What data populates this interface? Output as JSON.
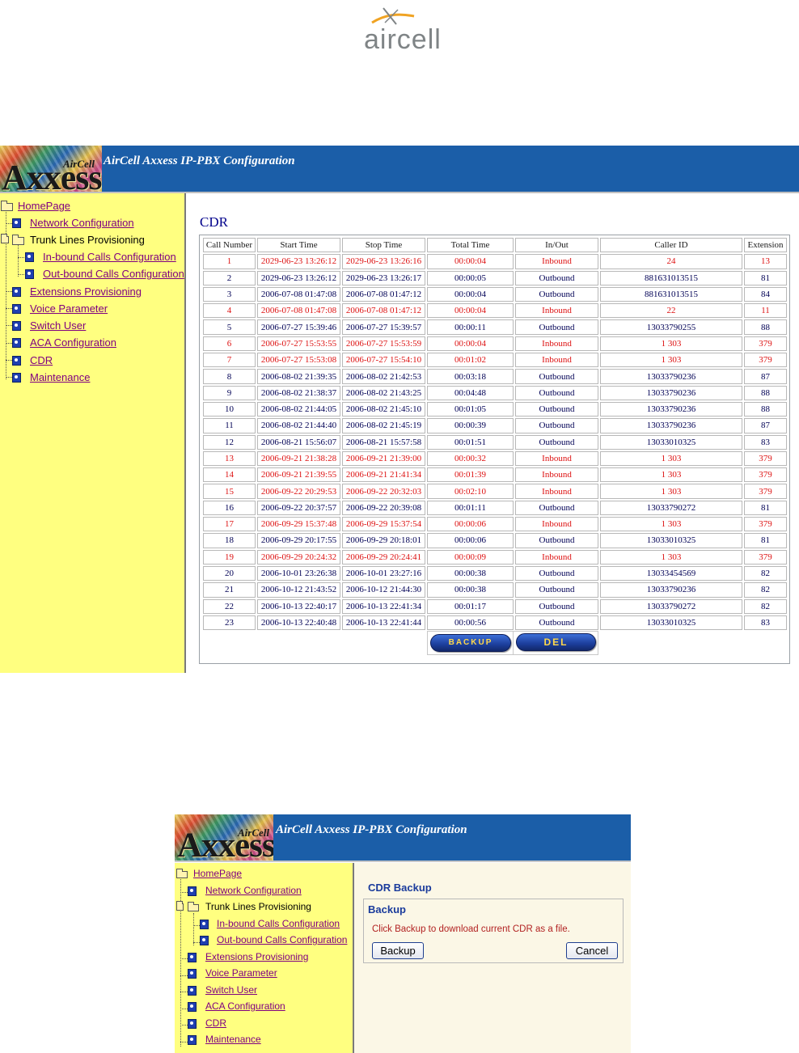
{
  "logo": {
    "text": "aircell",
    "icon": "aircell-swoosh-logo"
  },
  "app1": {
    "header_title": "AirCell Axxess IP-PBX Configuration",
    "brand_main": "Axxess",
    "brand_sup": "AirCell",
    "nav": [
      {
        "label": "HomePage",
        "icon": "folder-icon"
      },
      {
        "label": "Network Configuration",
        "icon": "page-icon"
      },
      {
        "label": "Trunk Lines Provisioning",
        "icon": "folder-icon"
      },
      {
        "label": "In-bound Calls Configuration",
        "icon": "page-icon"
      },
      {
        "label": "Out-bound Calls Configuration",
        "icon": "page-icon"
      },
      {
        "label": "Extensions Provisioning",
        "icon": "page-icon"
      },
      {
        "label": "Voice Parameter",
        "icon": "page-icon"
      },
      {
        "label": "Switch User",
        "icon": "page-icon"
      },
      {
        "label": "ACA Configuration",
        "icon": "page-icon"
      },
      {
        "label": "CDR",
        "icon": "page-icon"
      },
      {
        "label": "Maintenance",
        "icon": "page-icon"
      }
    ],
    "cdr_title": "CDR",
    "table": {
      "headers": [
        "Call Number",
        "Start Time",
        "Stop Time",
        "Total Time",
        "In/Out",
        "Caller ID",
        "Extension"
      ],
      "rows": [
        [
          "1",
          "2029-06-23 13:26:12",
          "2029-06-23 13:26:16",
          "00:00:04",
          "Inbound",
          "24",
          "13"
        ],
        [
          "2",
          "2029-06-23 13:26:12",
          "2029-06-23 13:26:17",
          "00:00:05",
          "Outbound",
          "881631013515",
          "81"
        ],
        [
          "3",
          "2006-07-08 01:47:08",
          "2006-07-08 01:47:12",
          "00:00:04",
          "Outbound",
          "881631013515",
          "84"
        ],
        [
          "4",
          "2006-07-08 01:47:08",
          "2006-07-08 01:47:12",
          "00:00:04",
          "Inbound",
          "22",
          "11"
        ],
        [
          "5",
          "2006-07-27 15:39:46",
          "2006-07-27 15:39:57",
          "00:00:11",
          "Outbound",
          "13033790255",
          "88"
        ],
        [
          "6",
          "2006-07-27 15:53:55",
          "2006-07-27 15:53:59",
          "00:00:04",
          "Inbound",
          "1 303",
          "379"
        ],
        [
          "7",
          "2006-07-27 15:53:08",
          "2006-07-27 15:54:10",
          "00:01:02",
          "Inbound",
          "1 303",
          "379"
        ],
        [
          "8",
          "2006-08-02 21:39:35",
          "2006-08-02 21:42:53",
          "00:03:18",
          "Outbound",
          "13033790236",
          "87"
        ],
        [
          "9",
          "2006-08-02 21:38:37",
          "2006-08-02 21:43:25",
          "00:04:48",
          "Outbound",
          "13033790236",
          "88"
        ],
        [
          "10",
          "2006-08-02 21:44:05",
          "2006-08-02 21:45:10",
          "00:01:05",
          "Outbound",
          "13033790236",
          "88"
        ],
        [
          "11",
          "2006-08-02 21:44:40",
          "2006-08-02 21:45:19",
          "00:00:39",
          "Outbound",
          "13033790236",
          "87"
        ],
        [
          "12",
          "2006-08-21 15:56:07",
          "2006-08-21 15:57:58",
          "00:01:51",
          "Outbound",
          "13033010325",
          "83"
        ],
        [
          "13",
          "2006-09-21 21:38:28",
          "2006-09-21 21:39:00",
          "00:00:32",
          "Inbound",
          "1 303",
          "379"
        ],
        [
          "14",
          "2006-09-21 21:39:55",
          "2006-09-21 21:41:34",
          "00:01:39",
          "Inbound",
          "1 303",
          "379"
        ],
        [
          "15",
          "2006-09-22 20:29:53",
          "2006-09-22 20:32:03",
          "00:02:10",
          "Inbound",
          "1 303",
          "379"
        ],
        [
          "16",
          "2006-09-22 20:37:57",
          "2006-09-22 20:39:08",
          "00:01:11",
          "Outbound",
          "13033790272",
          "81"
        ],
        [
          "17",
          "2006-09-29 15:37:48",
          "2006-09-29 15:37:54",
          "00:00:06",
          "Inbound",
          "1 303",
          "379"
        ],
        [
          "18",
          "2006-09-29 20:17:55",
          "2006-09-29 20:18:01",
          "00:00:06",
          "Outbound",
          "13033010325",
          "81"
        ],
        [
          "19",
          "2006-09-29 20:24:32",
          "2006-09-29 20:24:41",
          "00:00:09",
          "Inbound",
          "1 303",
          "379"
        ],
        [
          "20",
          "2006-10-01 23:26:38",
          "2006-10-01 23:27:16",
          "00:00:38",
          "Outbound",
          "13033454569",
          "82"
        ],
        [
          "21",
          "2006-10-12 21:43:52",
          "2006-10-12 21:44:30",
          "00:00:38",
          "Outbound",
          "13033790236",
          "82"
        ],
        [
          "22",
          "2006-10-13 22:40:17",
          "2006-10-13 22:41:34",
          "00:01:17",
          "Outbound",
          "13033790272",
          "82"
        ],
        [
          "23",
          "2006-10-13 22:40:48",
          "2006-10-13 22:41:44",
          "00:00:56",
          "Outbound",
          "13033010325",
          "83"
        ]
      ],
      "red_rows": [
        1,
        4,
        6,
        7,
        13,
        14,
        15,
        17,
        19
      ]
    },
    "backup_button": "BACKUP",
    "del_button": "DEL"
  },
  "app2": {
    "header_title": "AirCell Axxess IP-PBX Configuration",
    "brand_main": "Axxess",
    "brand_sup": "AirCell",
    "nav": [
      {
        "label": "HomePage",
        "icon": "folder-icon"
      },
      {
        "label": "Network Configuration",
        "icon": "page-icon"
      },
      {
        "label": "Trunk Lines Provisioning",
        "icon": "folder-icon"
      },
      {
        "label": "In-bound Calls Configuration",
        "icon": "page-icon"
      },
      {
        "label": "Out-bound Calls Configuration",
        "icon": "page-icon"
      },
      {
        "label": "Extensions Provisioning",
        "icon": "page-icon"
      },
      {
        "label": "Voice Parameter",
        "icon": "page-icon"
      },
      {
        "label": "Switch User",
        "icon": "page-icon"
      },
      {
        "label": "ACA Configuration",
        "icon": "page-icon"
      },
      {
        "label": "CDR",
        "icon": "page-icon"
      },
      {
        "label": "Maintenance",
        "icon": "page-icon"
      }
    ],
    "title": "CDR Backup",
    "section_title": "Backup",
    "message": "Click Backup to download current CDR as a file.",
    "backup_button": "Backup",
    "cancel_button": "Cancel"
  },
  "colors": {
    "header_blue": "#1b5ea8",
    "sidebar_yellow": "#ffff80",
    "inbound_red": "#dd1111",
    "outbound_navy": "#000055",
    "link_purple": "#800080"
  }
}
